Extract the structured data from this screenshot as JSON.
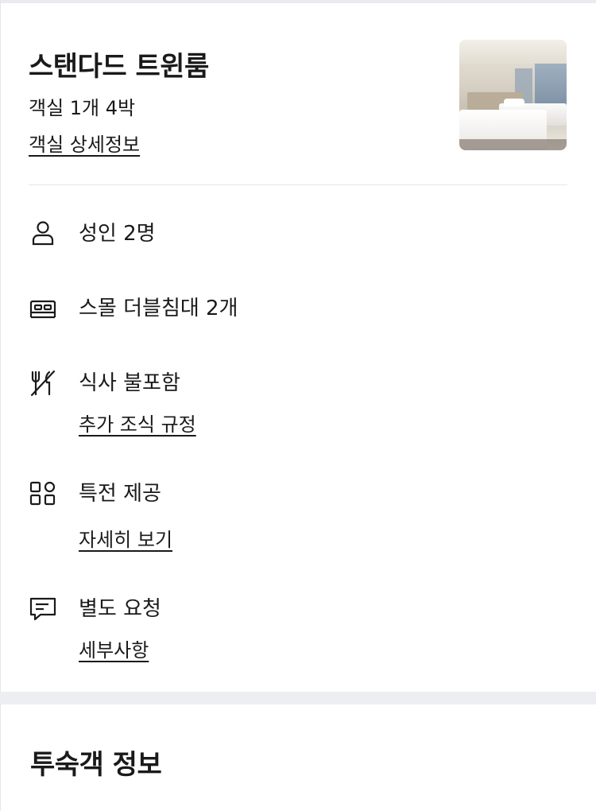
{
  "room": {
    "title": "스탠다드 트윈룸",
    "summary": "객실 1개 4박",
    "details_link": "객실 상세정보",
    "photo_alt": "standard twin room photo"
  },
  "features": {
    "guests": {
      "label": "성인 2명",
      "icon": "person-icon"
    },
    "bed": {
      "label": "스몰 더블침대 2개",
      "icon": "bed-icon"
    },
    "meal": {
      "label": "식사 불포함",
      "icon": "no-meal-icon",
      "link": "추가 조식 규정"
    },
    "perks": {
      "label": "특전 제공",
      "icon": "perks-icon",
      "link": "자세히 보기"
    },
    "requests": {
      "label": "별도 요청",
      "icon": "message-icon",
      "link": "세부사항"
    }
  },
  "guest_section": {
    "title": "투숙객 정보"
  },
  "colors": {
    "text": "#1a1a1a",
    "divider": "#e6e6e6",
    "section_gap": "#eceef1"
  }
}
